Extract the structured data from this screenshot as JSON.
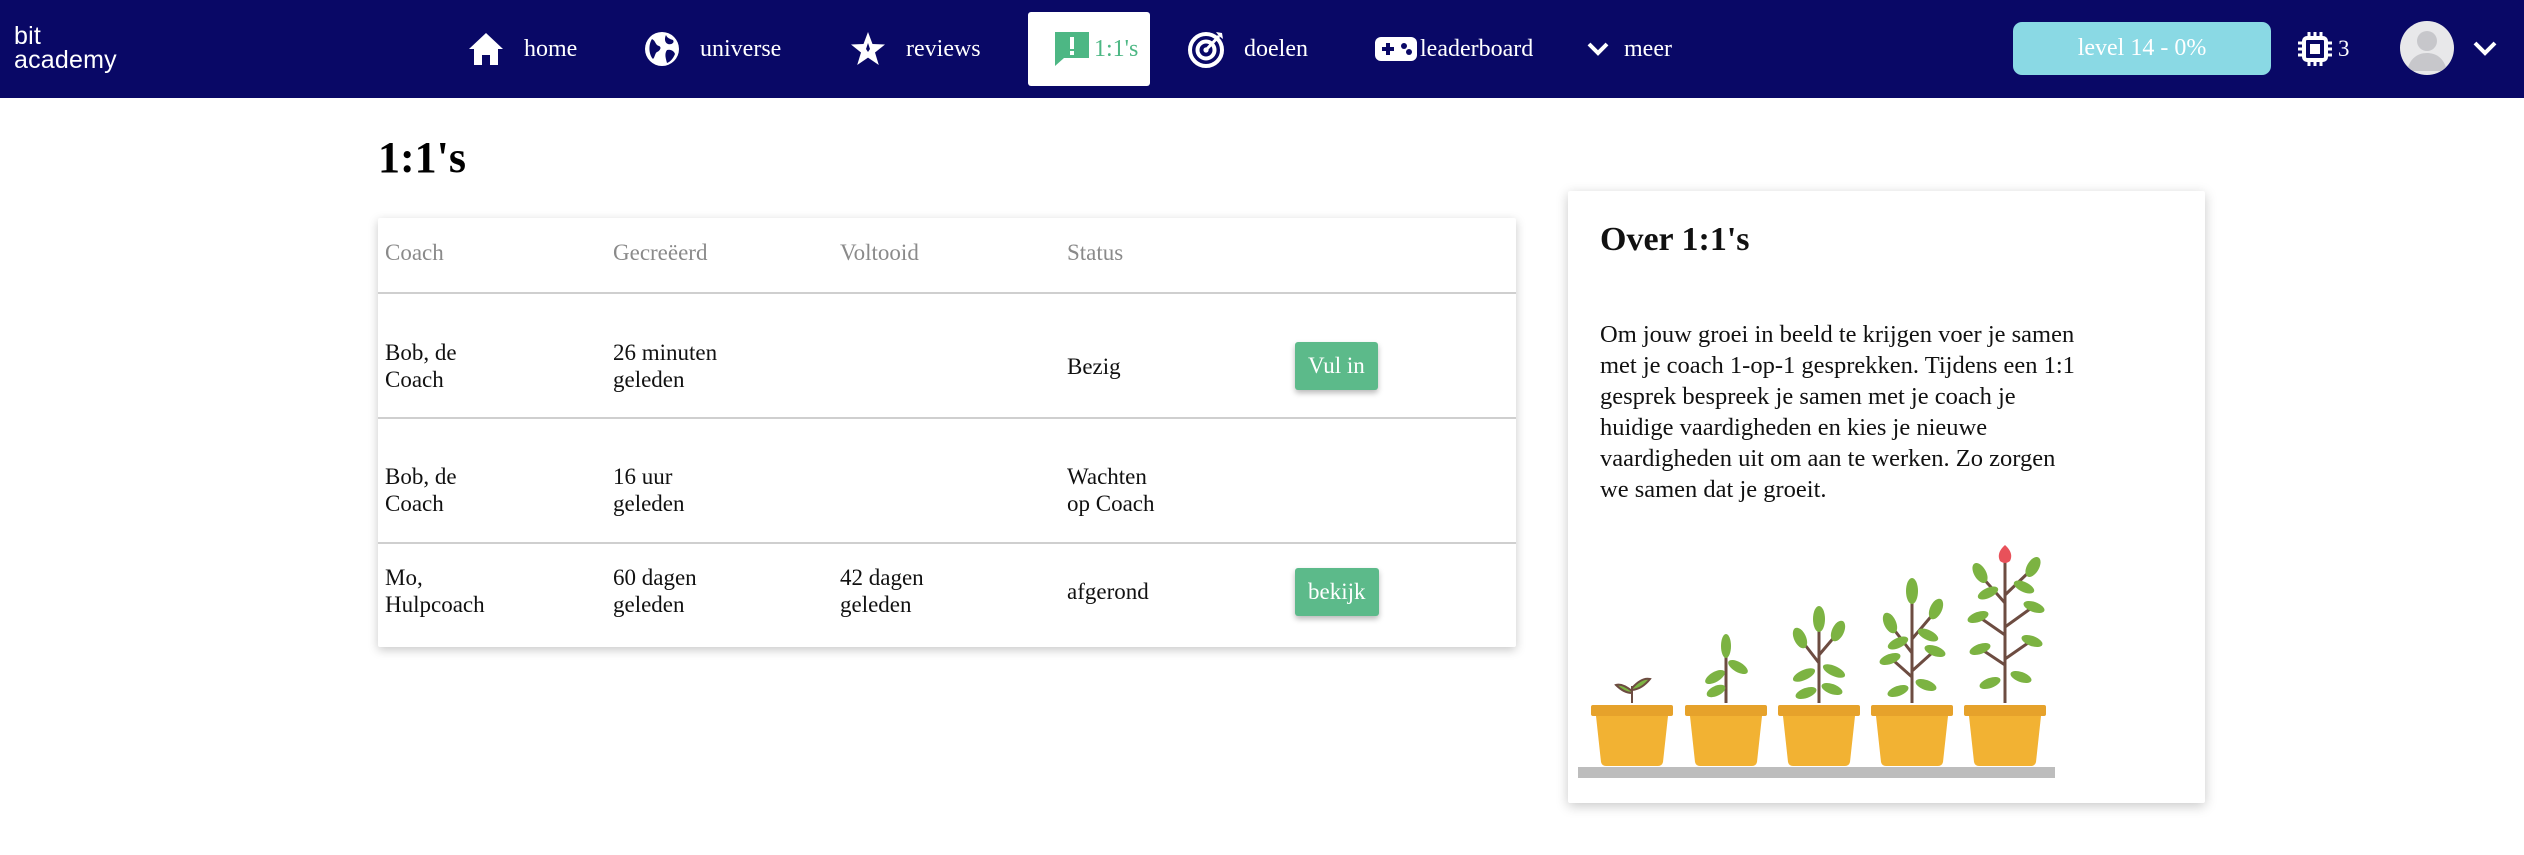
{
  "nav": {
    "logo_line1": "bit",
    "logo_line2": "academy",
    "items": [
      {
        "label": "home",
        "icon": "home-icon"
      },
      {
        "label": "universe",
        "icon": "globe-icon"
      },
      {
        "label": "reviews",
        "icon": "star-icon"
      },
      {
        "label": "1:1's",
        "icon": "chat-exclamation-icon",
        "active": true
      },
      {
        "label": "doelen",
        "icon": "target-icon"
      },
      {
        "label": "leaderboard",
        "icon": "gamepad-icon"
      },
      {
        "label": "meer",
        "icon": "chevron-down-icon"
      }
    ],
    "level_label": "level 14 - 0%",
    "credits": "3"
  },
  "page": {
    "title": "1:1's"
  },
  "table": {
    "headers": [
      "Coach",
      "Gecreëerd",
      "Voltooid",
      "Status"
    ],
    "rows": [
      {
        "coach_l1": "Bob, de",
        "coach_l2": "Coach",
        "created_l1": "26 minuten",
        "created_l2": "geleden",
        "done_l1": "",
        "done_l2": "",
        "status_l1": "Bezig",
        "status_l2": "",
        "action": "Vul in"
      },
      {
        "coach_l1": "Bob, de",
        "coach_l2": "Coach",
        "created_l1": "16 uur",
        "created_l2": "geleden",
        "done_l1": "",
        "done_l2": "",
        "status_l1": "Wachten",
        "status_l2": "op Coach",
        "action": ""
      },
      {
        "coach_l1": "Mo,",
        "coach_l2": "Hulpcoach",
        "created_l1": "60 dagen",
        "created_l2": "geleden",
        "done_l1": "42 dagen",
        "done_l2": "geleden",
        "status_l1": "afgerond",
        "status_l2": "",
        "action": "bekijk"
      }
    ]
  },
  "info": {
    "title": "Over 1:1's",
    "text": "Om jouw groei in beeld te krijgen voer je samen met je coach 1-op-1 gesprekken. Tijdens een 1:1 gesprek bespreek je samen met je coach je huidige vaardigheden en kies je nieuwe vaardigheden uit om aan te werken. Zo zorgen we samen dat je groeit."
  },
  "colors": {
    "navbar": "#090866",
    "accent_green": "#5cba8a",
    "level_button": "#8ad9e4",
    "pot": "#f2b233",
    "leaf": "#7cb342",
    "flower": "#e8515a"
  }
}
